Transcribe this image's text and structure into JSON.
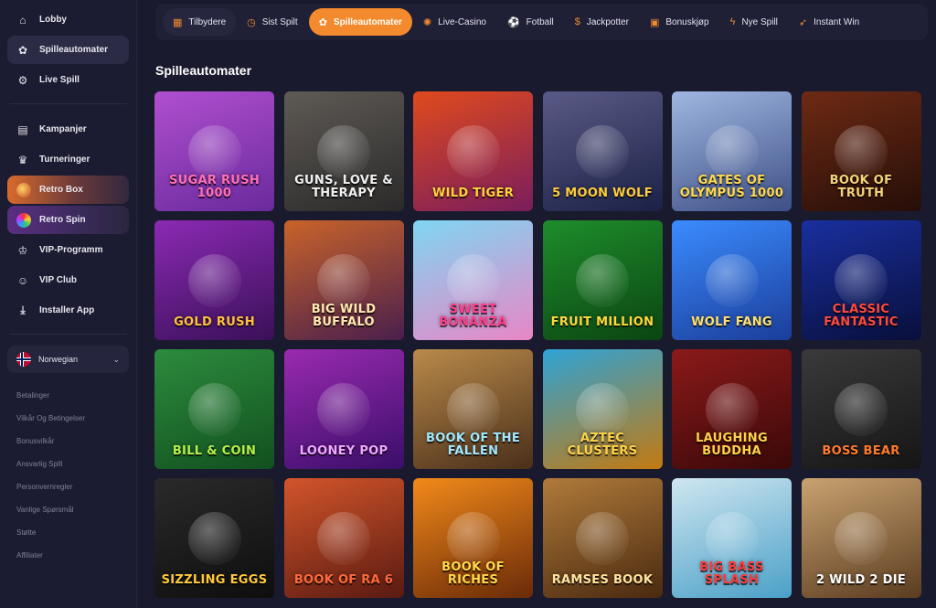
{
  "sidebar": {
    "primary": [
      {
        "label": "Lobby",
        "icon": "home-icon"
      },
      {
        "label": "Spilleautomater",
        "icon": "slot-icon",
        "active": true
      },
      {
        "label": "Live Spill",
        "icon": "roulette-icon"
      }
    ],
    "secondary": [
      {
        "label": "Kampanjer",
        "icon": "gift-icon"
      },
      {
        "label": "Turneringer",
        "icon": "trophy-icon"
      },
      {
        "label": "Retro Box",
        "icon": "retro-box-thumb"
      },
      {
        "label": "Retro Spin",
        "icon": "retro-spin-thumb"
      },
      {
        "label": "VIP-Programm",
        "icon": "crown-icon"
      },
      {
        "label": "VIP Club",
        "icon": "user-icon"
      },
      {
        "label": "Installer App",
        "icon": "download-icon"
      }
    ],
    "language": "Norwegian",
    "footer_links": [
      "Betalinger",
      "Vilkår Og Betingelser",
      "Bonusvilkår",
      "Ansvarlig Spill",
      "Personvernregler",
      "Vanlige Spørsmål",
      "Støtte",
      "Affiliater"
    ]
  },
  "tabs": [
    {
      "label": "Tilbydere",
      "icon": "providers-icon"
    },
    {
      "label": "Sist Spilt",
      "icon": "clock-icon"
    },
    {
      "label": "Spilleautomater",
      "icon": "cherry-icon",
      "active": true
    },
    {
      "label": "Live-Casino",
      "icon": "chip-icon"
    },
    {
      "label": "Fotball",
      "icon": "football-icon"
    },
    {
      "label": "Jackpotter",
      "icon": "moneybag-icon"
    },
    {
      "label": "Bonuskjøp",
      "icon": "gift-box-icon"
    },
    {
      "label": "Nye Spill",
      "icon": "lightning-icon"
    },
    {
      "label": "Instant Win",
      "icon": "rocket-icon"
    }
  ],
  "section_title": "Spilleautomater",
  "games": [
    {
      "title": "Sugar Rush 1000",
      "bg": [
        "#b04fd0",
        "#6a2a9c"
      ],
      "text_color": "#ff6fb5"
    },
    {
      "title": "Guns, Love & Therapy",
      "bg": [
        "#5e5a55",
        "#2b2a2a"
      ],
      "text_color": "#f0f0f0"
    },
    {
      "title": "Wild Tiger",
      "bg": [
        "#e04a1c",
        "#7a1d5c"
      ],
      "text_color": "#ffd23a"
    },
    {
      "title": "5 Moon Wolf",
      "bg": [
        "#5a5a86",
        "#1b2146"
      ],
      "text_color": "#ffcd3a"
    },
    {
      "title": "Gates of Olympus 1000",
      "bg": [
        "#9fb7e0",
        "#3d4f86"
      ],
      "text_color": "#ffd94a"
    },
    {
      "title": "Book of Truth",
      "bg": [
        "#6e2a14",
        "#250e08"
      ],
      "text_color": "#f3d37a"
    },
    {
      "title": "Gold Rush",
      "bg": [
        "#8b2ab4",
        "#3a1058"
      ],
      "text_color": "#ffc13a"
    },
    {
      "title": "Big Wild Buffalo",
      "bg": [
        "#c9632a",
        "#4a1f4c"
      ],
      "text_color": "#ffe9b0"
    },
    {
      "title": "Sweet Bonanza",
      "bg": [
        "#7fd6f2",
        "#e986c6"
      ],
      "text_color": "#ff3f8c"
    },
    {
      "title": "Fruit Million",
      "bg": [
        "#1e8d2b",
        "#0b4512"
      ],
      "text_color": "#ffd93a"
    },
    {
      "title": "Wolf Fang",
      "bg": [
        "#3b8cff",
        "#1b3d9a"
      ],
      "text_color": "#ffe06a"
    },
    {
      "title": "Classic Fantastic",
      "bg": [
        "#1a2fa0",
        "#080f3a"
      ],
      "text_color": "#ff4a3a"
    },
    {
      "title": "Bill & Coin",
      "bg": [
        "#2c8c3c",
        "#125020"
      ],
      "text_color": "#b6f04a"
    },
    {
      "title": "Looney Pop",
      "bg": [
        "#9a2ab0",
        "#3a0e6a"
      ],
      "text_color": "#f0a8ff"
    },
    {
      "title": "Book of the Fallen",
      "bg": [
        "#b98a4a",
        "#4a2f1a"
      ],
      "text_color": "#9fe8ff"
    },
    {
      "title": "Aztec Clusters",
      "bg": [
        "#2ea3d6",
        "#c47a10"
      ],
      "text_color": "#ffd24a"
    },
    {
      "title": "Laughing Buddha",
      "bg": [
        "#8b1a1a",
        "#3a0808"
      ],
      "text_color": "#ffd24a"
    },
    {
      "title": "Boss Bear",
      "bg": [
        "#3a3a3a",
        "#151515"
      ],
      "text_color": "#ff7a2a"
    },
    {
      "title": "Sizzling Eggs",
      "bg": [
        "#2a2a2a",
        "#0e0e0e"
      ],
      "text_color": "#ffc93a"
    },
    {
      "title": "Book of Ra 6",
      "bg": [
        "#d2552a",
        "#5a1a12"
      ],
      "text_color": "#ff6a3a"
    },
    {
      "title": "Book of Riches",
      "bg": [
        "#f28a1a",
        "#6a2a08"
      ],
      "text_color": "#ffd84a"
    },
    {
      "title": "Ramses Book",
      "bg": [
        "#b07a3a",
        "#4a2a10"
      ],
      "text_color": "#ffe3a0"
    },
    {
      "title": "Big Bass Splash",
      "bg": [
        "#cfe6f0",
        "#4aa0c8"
      ],
      "text_color": "#ff3a3a"
    },
    {
      "title": "2 Wild 2 Die",
      "bg": [
        "#c9a270",
        "#5a3c20"
      ],
      "text_color": "#ffffff"
    }
  ]
}
